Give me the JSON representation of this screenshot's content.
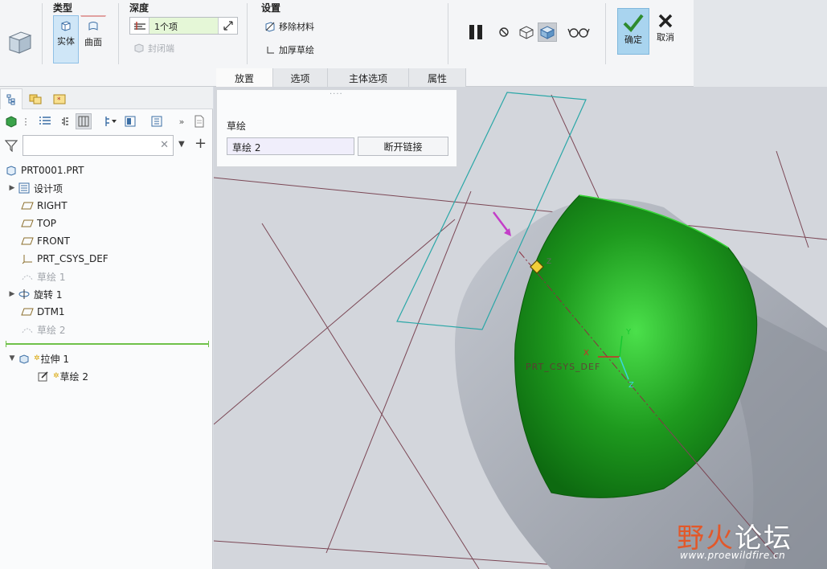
{
  "ribbon": {
    "type_group": {
      "title": "类型",
      "solid": "实体",
      "surface": "曲面"
    },
    "depth_group": {
      "title": "深度",
      "value": "1个项",
      "capped": "封闭端"
    },
    "settings_group": {
      "title": "设置",
      "remove_material": "移除材料",
      "thicken_sketch": "加厚草绘"
    },
    "confirm": "确定",
    "cancel": "取消",
    "tabs": [
      "放置",
      "选项",
      "主体选项",
      "属性"
    ]
  },
  "placement_panel": {
    "label": "草绘",
    "collector_value": "草绘 2",
    "break_link": "断开链接"
  },
  "model_tree": {
    "items": [
      {
        "label": "PRT0001.PRT",
        "icon": "part-icon"
      },
      {
        "label": "设计项",
        "icon": "design-items-icon"
      },
      {
        "label": "RIGHT",
        "icon": "datum-plane-icon"
      },
      {
        "label": "TOP",
        "icon": "datum-plane-icon"
      },
      {
        "label": "FRONT",
        "icon": "datum-plane-icon"
      },
      {
        "label": "PRT_CSYS_DEF",
        "icon": "csys-icon"
      },
      {
        "label": "草绘 1",
        "icon": "sketch-icon"
      },
      {
        "label": "旋转 1",
        "icon": "revolve-icon"
      },
      {
        "label": "DTM1",
        "icon": "datum-plane-icon"
      },
      {
        "label": "草绘 2",
        "icon": "sketch-icon"
      },
      {
        "label": "拉伸 1",
        "icon": "extrude-icon"
      },
      {
        "label": "草绘 2",
        "icon": "sketch-icon"
      }
    ]
  },
  "viewport": {
    "csys_label": "PRT_CSYS_DEF",
    "axis_x": "X",
    "axis_y": "Y",
    "axis_z": "Z",
    "point_label": "Z"
  },
  "watermark": {
    "text_a": "野火",
    "text_b": "论坛",
    "url": "www.proewildfire.cn"
  },
  "colors": {
    "accent_green": "#1f9a1a",
    "sketch_teal": "#2aa7a7",
    "body_gray": "#a6abb6",
    "confirm_bg": "#a9d4ef"
  }
}
